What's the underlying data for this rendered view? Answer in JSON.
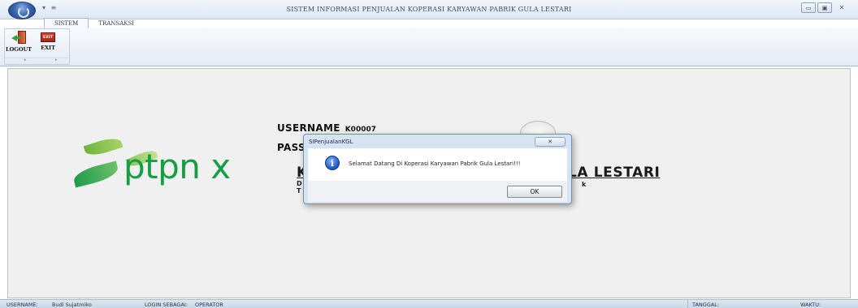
{
  "window": {
    "title": "SISTEM INFORMASI PENJUALAN KOPERASI KARYAWAN PABRIK GULA LESTARI",
    "qat": "▾ ≡",
    "controls": {
      "minimize": "▭",
      "maximize": "▣",
      "close": "✕"
    }
  },
  "ribbon": {
    "tabs": [
      "SISTEM",
      "TRANSAKSI"
    ],
    "active_tab": "SISTEM",
    "buttons": {
      "logout": "LOGOUT",
      "exit": "EXIT",
      "exit_icon_text": "EXIT"
    },
    "group_markers": [
      "▸",
      "▸"
    ]
  },
  "main": {
    "logo_text": "ptpn x",
    "company_name": "KOPERASI KARYAWAN PABRIK GULA LESTARI",
    "sub_line1_start": "D",
    "sub_line1_end": "k",
    "sub_line2_start": "T",
    "login_form": {
      "username_label": "USERNAME",
      "username_value": "K00007",
      "password_label": "PASS"
    }
  },
  "dialog": {
    "title": "SIPenjualanKGL",
    "close_glyph": "✕",
    "icon_glyph": "i",
    "message": "Selamat Datang Di Koperasi Karyawan Pabrik Gula Lestari!!!",
    "ok_label": "OK"
  },
  "status_bar": {
    "username_label": "USERNAME:",
    "username_value": "Budi Sujatmiko",
    "login_as_label": "LOGIN SEBAGAI:",
    "login_as_value": "OPERATOR",
    "date_label": "TANGGAL:",
    "time_label": "WAKTU:"
  },
  "colors": {
    "logo_green": "#12a043",
    "dialog_frame": "#d6e3f2",
    "ribbon_bg": "#e4ebf4",
    "main_bg": "#f0f0f0"
  }
}
